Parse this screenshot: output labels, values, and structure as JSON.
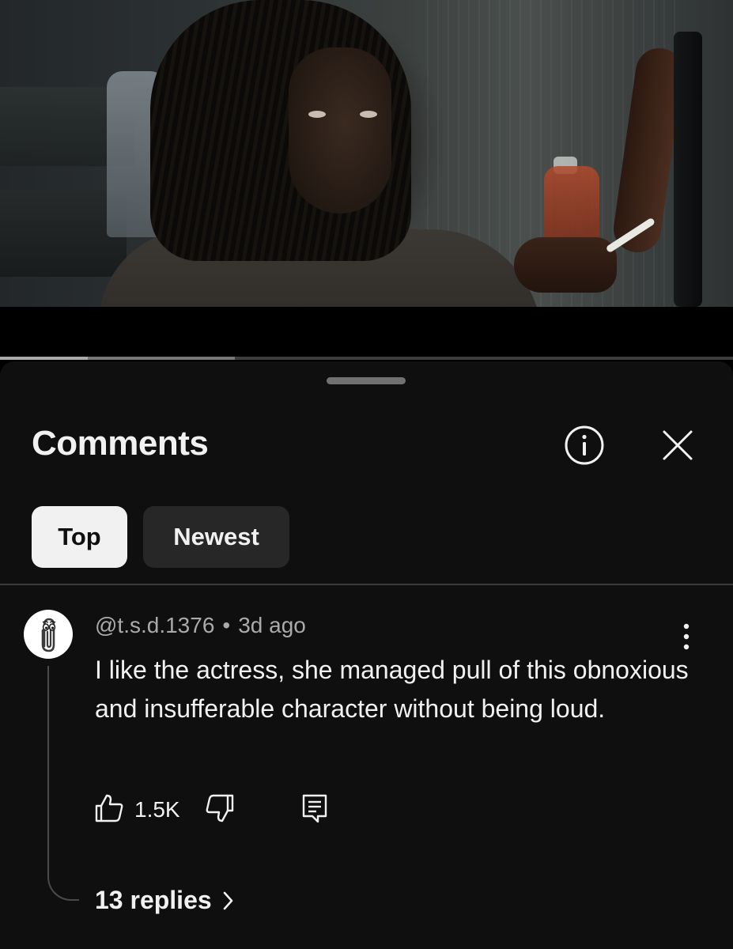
{
  "video": {
    "played_fraction": 0.12,
    "buffered_fraction": 0.32
  },
  "comments_panel": {
    "title": "Comments",
    "info_icon": "info-circle-icon",
    "close_icon": "close-x-icon",
    "filters": [
      {
        "label": "Top",
        "selected": true
      },
      {
        "label": "Newest",
        "selected": false
      }
    ]
  },
  "comment": {
    "author": "@t.s.d.1376",
    "separator": "•",
    "time": "3d ago",
    "text": "I like the actress, she managed pull of this obnoxious and insufferable character without being loud.",
    "like_count": "1.5K",
    "replies_label": "13 replies",
    "avatar_icon": "paperclip-avatar-icon"
  },
  "colors": {
    "background": "#0f0f0f",
    "text_primary": "#f1f1f1",
    "text_secondary": "#aaaaaa",
    "chip_selected_bg": "#f1f1f1",
    "chip_bg": "#272727"
  }
}
